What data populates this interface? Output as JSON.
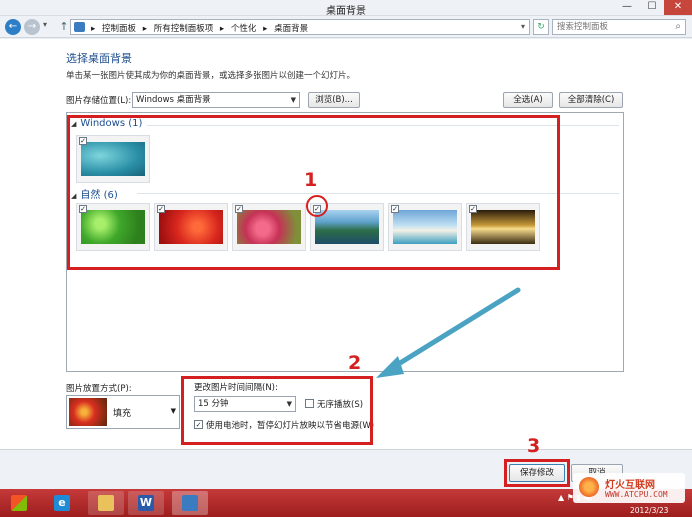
{
  "window": {
    "title": "桌面背景",
    "min": "—",
    "max": "☐",
    "close": "✕"
  },
  "address": {
    "back": "←",
    "forward": "→",
    "history": "▾",
    "up": "↑",
    "crumbs": [
      "控制面板",
      "所有控制面板项",
      "个性化",
      "桌面背景"
    ],
    "separator": "▸",
    "refresh": "↻",
    "search_placeholder": "搜索控制面板",
    "search_icon_glyph": "⌕"
  },
  "page": {
    "heading": "选择桌面背景",
    "description": "单击某一张图片使其成为你的桌面背景，或选择多张图片以创建一个幻灯片。",
    "location_label": "图片存储位置(L):",
    "location_value": "Windows 桌面背景",
    "browse": "浏览(B)...",
    "select_all": "全选(A)",
    "clear_all": "全部清除(C)"
  },
  "gallery": {
    "groups": [
      {
        "name": "Windows (1)",
        "items": [
          {
            "id": "win",
            "checked": true
          }
        ]
      },
      {
        "name": "自然 (6)",
        "items": [
          {
            "id": "n1",
            "checked": true
          },
          {
            "id": "n2",
            "checked": true
          },
          {
            "id": "n3",
            "checked": true
          },
          {
            "id": "n4",
            "checked": true
          },
          {
            "id": "n5",
            "checked": true
          },
          {
            "id": "n6",
            "checked": true
          }
        ]
      }
    ],
    "check_glyph": "✓",
    "collapse_glyph": "◢"
  },
  "position": {
    "label": "图片放置方式(P):",
    "value": "填充"
  },
  "interval": {
    "label": "更改图片时间间隔(N):",
    "value": "15 分钟",
    "shuffle_label": "无序播放(S)",
    "shuffle_checked": false,
    "battery_label": "使用电池时，暂停幻灯片放映以节省电源(W)",
    "battery_checked": true
  },
  "footer": {
    "save": "保存修改",
    "cancel": "取消"
  },
  "annotations": [
    "1",
    "2",
    "3"
  ],
  "taskbar": {
    "clock": "2012/3/23"
  },
  "watermark": {
    "line1": "灯火互联网",
    "line2": "WWW.ATCPU.COM"
  },
  "colors": {
    "annotation": "#d42020",
    "arrow": "#4aa3c3",
    "link_heading": "#1d4e8f",
    "taskbar": "#b32a2a"
  }
}
